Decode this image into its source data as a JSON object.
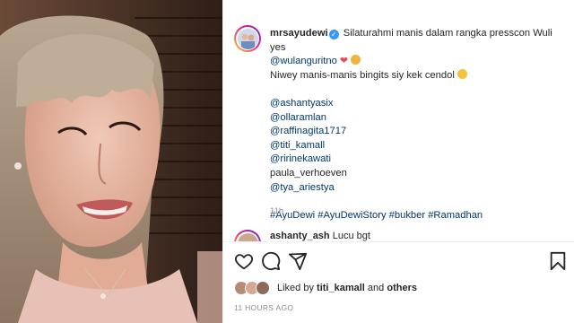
{
  "post": {
    "username": "mrsayudewi",
    "caption_line1": "Silaturahmi manis dalam rangka presscon Wuli yes",
    "mention_line2": "@wulanguritno",
    "caption_line3": "Niwey manis-manis bingits siy kek cendol",
    "mentions": [
      "@ashantyasix",
      "@ollaramlan",
      "@raffinagita1717",
      "@titi_kamall",
      "@ririnekawati"
    ],
    "plain_mention": "paula_verhoeven",
    "mention_last": "@tya_ariestya",
    "hashtags": "#AyuDewi #AyuDewiStory #bukber #Ramadhan",
    "age": "11h"
  },
  "next_comment": {
    "username": "ashanty_ash",
    "text": "Lucu bgt"
  },
  "icons": {
    "like": "heart-icon",
    "comment": "comment-icon",
    "share": "share-icon",
    "save": "bookmark-icon"
  },
  "likes": {
    "prefix": "Liked by",
    "user": "titi_kamall",
    "middle": "and",
    "others": "others"
  },
  "timestamp": "11 HOURS AGO",
  "colors": {
    "link": "#00376b",
    "verified": "#3897f0",
    "heart": "#ed4956",
    "muted": "#8e8e8e"
  }
}
